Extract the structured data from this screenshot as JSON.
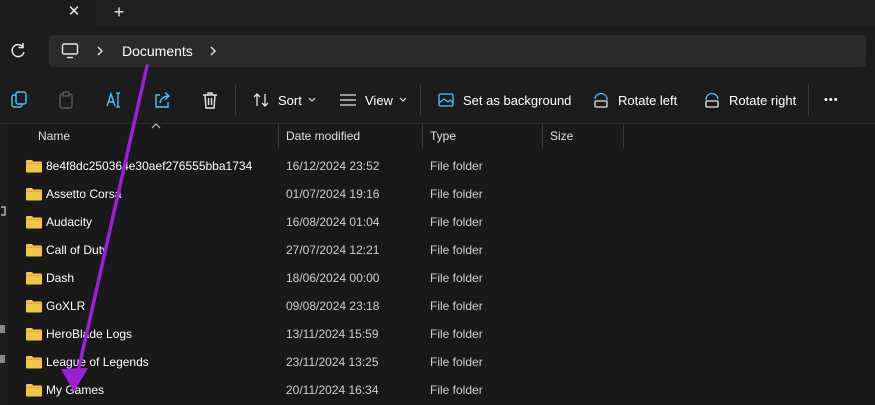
{
  "address": {
    "crumbs": [
      "Documents"
    ]
  },
  "toolbar": {
    "sort_label": "Sort",
    "view_label": "View",
    "background_label": "Set as background",
    "rotate_left_label": "Rotate left",
    "rotate_right_label": "Rotate right",
    "more_label": "•••"
  },
  "columns": {
    "name": "Name",
    "date": "Date modified",
    "type": "Type",
    "size": "Size"
  },
  "rows": [
    {
      "name": "8e4f8dc250364e30aef276555bba1734",
      "date": "16/12/2024 23:52",
      "type": "File folder"
    },
    {
      "name": "Assetto Corsa",
      "date": "01/07/2024 19:16",
      "type": "File folder"
    },
    {
      "name": "Audacity",
      "date": "16/08/2024 01:04",
      "type": "File folder"
    },
    {
      "name": "Call of Duty",
      "date": "27/07/2024 12:21",
      "type": "File folder"
    },
    {
      "name": "Dash",
      "date": "18/06/2024 00:00",
      "type": "File folder"
    },
    {
      "name": "GoXLR",
      "date": "09/08/2024 23:18",
      "type": "File folder"
    },
    {
      "name": "HeroBlade Logs",
      "date": "13/11/2024 15:59",
      "type": "File folder"
    },
    {
      "name": "League of Legends",
      "date": "23/11/2024 13:25",
      "type": "File folder"
    },
    {
      "name": "My Games",
      "date": "20/11/2024 16:34",
      "type": "File folder"
    }
  ],
  "icons": {
    "tab_close": "close-icon",
    "tab_new": "plus-icon",
    "refresh": "refresh-icon",
    "pc": "monitor-icon",
    "copy": "copy-icon",
    "paste": "paste-icon",
    "rename": "rename-icon",
    "share": "share-icon",
    "delete": "trash-icon",
    "folder": "folder-icon",
    "annotation": "arrow-annotation"
  },
  "colors": {
    "background": "#191919",
    "folder": "#f4c545",
    "annotation_arrow": "#9b1fd9",
    "accent": "#4cc2ff"
  }
}
